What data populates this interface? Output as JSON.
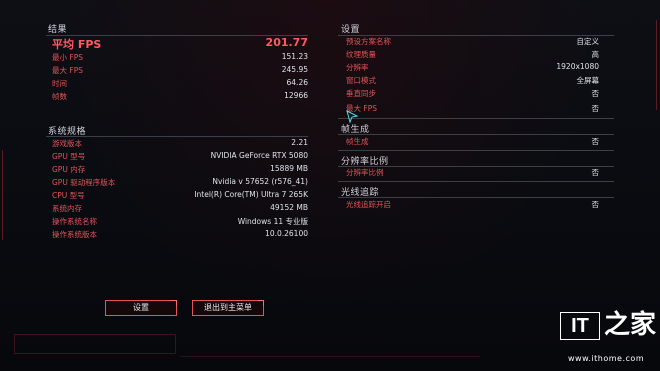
{
  "results": {
    "title": "结果",
    "avg_fps": {
      "label": "平均 FPS",
      "value": "201.77"
    },
    "rows": [
      {
        "label": "最小 FPS",
        "value": "151.23"
      },
      {
        "label": "最大 FPS",
        "value": "245.95"
      },
      {
        "label": "时间",
        "value": "64.26"
      },
      {
        "label": "帧数",
        "value": "12966"
      }
    ]
  },
  "system_specs": {
    "title": "系统规格",
    "rows": [
      {
        "label": "游戏版本",
        "value": "2.21"
      },
      {
        "label": "GPU 型号",
        "value": "NVIDIA GeForce RTX 5080"
      },
      {
        "label": "GPU 内存",
        "value": "15889 MB"
      },
      {
        "label": "GPU 驱动程序版本",
        "value": "Nvidia v 57652 (r576_41)"
      },
      {
        "label": "CPU 型号",
        "value": "Intel(R) Core(TM) Ultra 7 265K"
      },
      {
        "label": "系统内存",
        "value": "49152 MB"
      },
      {
        "label": "操作系统名称",
        "value": "Windows 11 专业版"
      },
      {
        "label": "操作系统版本",
        "value": "10.0.26100"
      }
    ]
  },
  "settings": {
    "title": "设置",
    "rows": [
      {
        "label": "预设方案名称",
        "value": "自定义"
      },
      {
        "label": "纹理质量",
        "value": "高"
      },
      {
        "label": "分辨率",
        "value": "1920x1080"
      },
      {
        "label": "窗口模式",
        "value": "全屏幕"
      },
      {
        "label": "垂直同步",
        "value": "否"
      },
      {
        "label": "最大 FPS",
        "value": "否"
      }
    ]
  },
  "frame_gen": {
    "title": "帧生成",
    "rows": [
      {
        "label": "帧生成",
        "value": "否"
      }
    ]
  },
  "res_scale": {
    "title": "分辨率比例",
    "rows": [
      {
        "label": "分辨率比例",
        "value": "否"
      }
    ]
  },
  "ray_tracing": {
    "title": "光线追踪",
    "rows": [
      {
        "label": "光线追踪开启",
        "value": "否"
      }
    ]
  },
  "buttons": {
    "settings": "设置",
    "exit": "退出到主菜单"
  },
  "watermark": {
    "logo_it": "IT",
    "logo_zh": "之家",
    "url": "www.ithome.com"
  },
  "colors": {
    "accent": "#e0555a",
    "highlight": "#ff5a5f",
    "value": "#dfe3ea"
  }
}
